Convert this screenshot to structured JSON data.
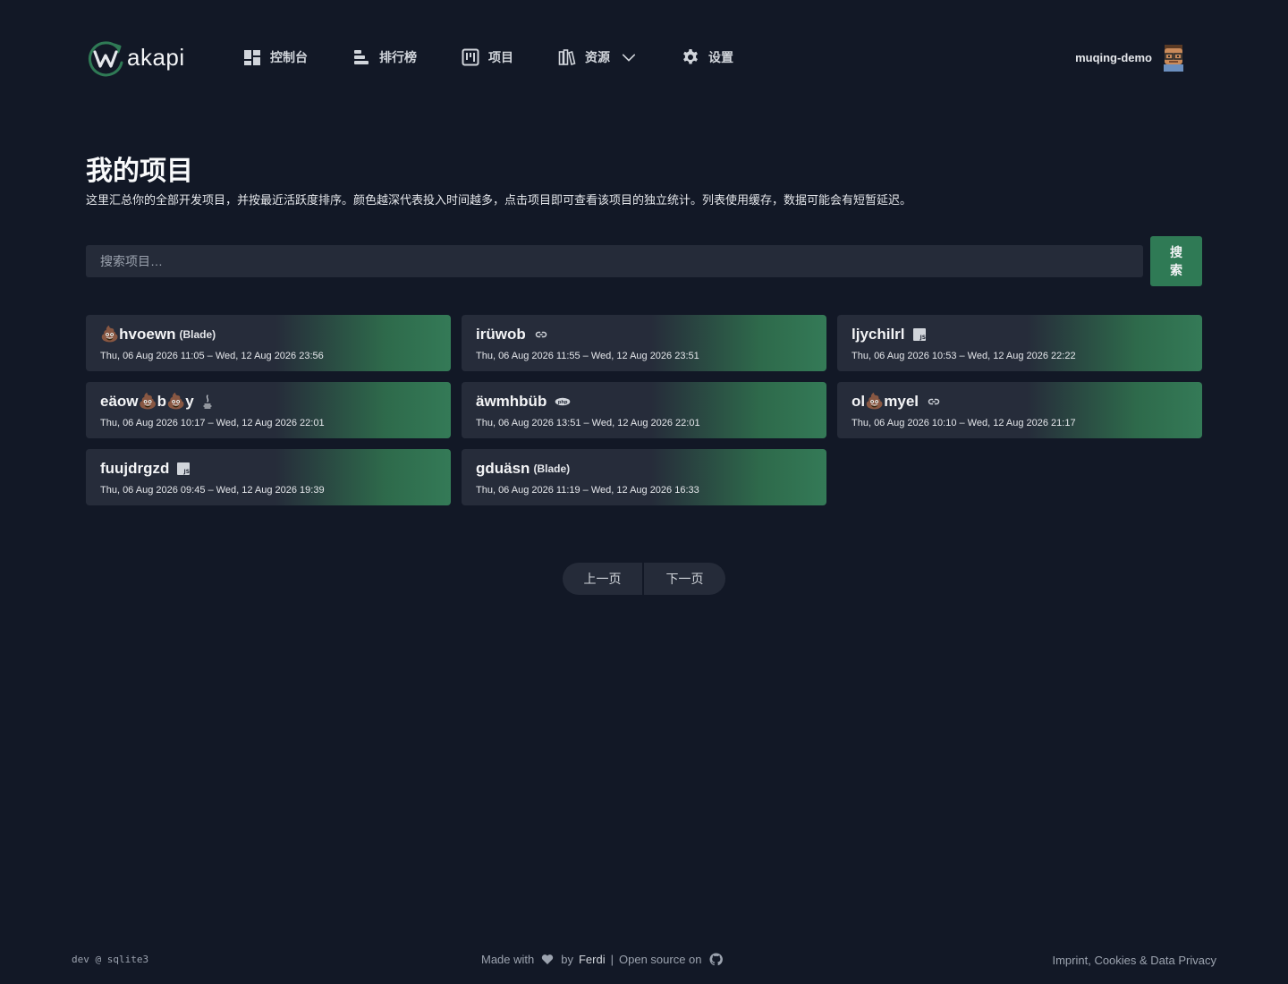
{
  "app": {
    "name": "akapi"
  },
  "nav": {
    "dashboard": "控制台",
    "leaderboard": "排行榜",
    "projects": "项目",
    "resources": "资源",
    "settings": "设置"
  },
  "user": {
    "name": "muqing-demo"
  },
  "page": {
    "title": "我的项目",
    "description": "这里汇总你的全部开发项目，并按最近活跃度排序。颜色越深代表投入时间越多，点击项目即可查看该项目的独立统计。列表使用缓存，数据可能会有短暂延迟。"
  },
  "search": {
    "placeholder": "搜索项目…",
    "button": "搜索"
  },
  "projects": [
    {
      "name": "💩hvoewn",
      "branch": "(Blade)",
      "icon": "",
      "dates": "Thu, 06 Aug 2026 11:05 – Wed, 12 Aug 2026 23:56"
    },
    {
      "name": "irüwob",
      "branch": "",
      "icon": "link-icon",
      "dates": "Thu, 06 Aug 2026 11:55 – Wed, 12 Aug 2026 23:51"
    },
    {
      "name": "ljychilrl",
      "branch": "",
      "icon": "javascript-icon",
      "dates": "Thu, 06 Aug 2026 10:53 – Wed, 12 Aug 2026 22:22"
    },
    {
      "name": "eäow💩b💩y",
      "branch": "",
      "icon": "java-icon",
      "dates": "Thu, 06 Aug 2026 10:17 – Wed, 12 Aug 2026 22:01"
    },
    {
      "name": "äwmhbüb",
      "branch": "",
      "icon": "php-icon",
      "dates": "Thu, 06 Aug 2026 13:51 – Wed, 12 Aug 2026 22:01"
    },
    {
      "name": "ol💩myel",
      "branch": "",
      "icon": "link-icon",
      "dates": "Thu, 06 Aug 2026 10:10 – Wed, 12 Aug 2026 21:17"
    },
    {
      "name": "fuujdrgzd",
      "branch": "",
      "icon": "javascript-icon",
      "dates": "Thu, 06 Aug 2026 09:45 – Wed, 12 Aug 2026 19:39"
    },
    {
      "name": "gduäsn",
      "branch": "(Blade)",
      "icon": "",
      "dates": "Thu, 06 Aug 2026 11:19 – Wed, 12 Aug 2026 16:33"
    }
  ],
  "pagination": {
    "prev": "上一页",
    "next": "下一页"
  },
  "footer": {
    "version": "dev @ sqlite3",
    "made_with": "Made with",
    "by": "by",
    "author": "Ferdi",
    "separator": "|",
    "open_source": "Open source on",
    "privacy": "Imprint, Cookies & Data Privacy"
  },
  "colors": {
    "accent": "#2f7a55",
    "background": "#121826",
    "card": "#262c3a"
  }
}
